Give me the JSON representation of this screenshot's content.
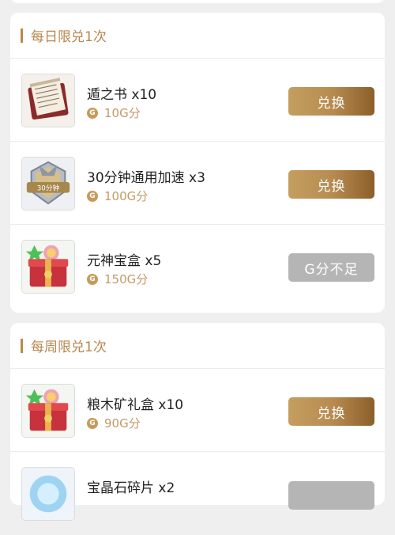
{
  "sections": [
    {
      "title": "每日限兑1次",
      "items": [
        {
          "name": "遁之书 x10",
          "price": "10G分",
          "button": "兑换",
          "enabled": true,
          "icon": "scroll-book-icon"
        },
        {
          "name": "30分钟通用加速 x3",
          "price": "100G分",
          "button": "兑换",
          "enabled": true,
          "icon": "speedup-badge-icon",
          "badge_text": "30分钟"
        },
        {
          "name": "元神宝盒 x5",
          "price": "150G分",
          "button": "G分不足",
          "enabled": false,
          "icon": "gift-box-icon"
        }
      ]
    },
    {
      "title": "每周限兑1次",
      "items": [
        {
          "name": "粮木矿礼盒 x10",
          "price": "90G分",
          "button": "兑换",
          "enabled": true,
          "icon": "gift-box-icon"
        },
        {
          "name": "宝晶石碎片 x2",
          "price": "",
          "button": "",
          "enabled": false,
          "icon": "gem-fragment-icon"
        }
      ]
    }
  ],
  "coin_symbol": "G",
  "colors": {
    "accent": "#b7864e",
    "button_gold": "#b88c51",
    "button_disabled": "#b5b5b5"
  }
}
